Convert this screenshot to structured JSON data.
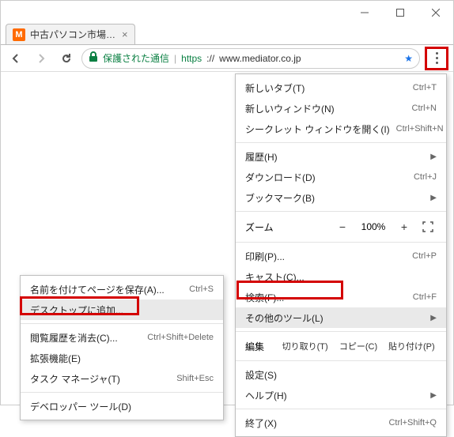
{
  "window": {
    "favicon_letter": "M",
    "tab_title": "中古パソコン市場 中古PCの"
  },
  "addr": {
    "secure_label": "保護された通信",
    "https": "https",
    "sep": "://",
    "rest": "www.mediator.co.jp"
  },
  "menu": {
    "new_tab": "新しいタブ(T)",
    "new_tab_sc": "Ctrl+T",
    "new_window": "新しいウィンドウ(N)",
    "new_window_sc": "Ctrl+N",
    "incognito": "シークレット ウィンドウを開く(I)",
    "incognito_sc": "Ctrl+Shift+N",
    "history": "履歴(H)",
    "downloads": "ダウンロード(D)",
    "downloads_sc": "Ctrl+J",
    "bookmarks": "ブックマーク(B)",
    "zoom_label": "ズーム",
    "zoom_value": "100%",
    "print": "印刷(P)...",
    "print_sc": "Ctrl+P",
    "cast": "キャスト(C)...",
    "find": "検索(F)...",
    "find_sc": "Ctrl+F",
    "more_tools": "その他のツール(L)",
    "edit_label": "編集",
    "cut": "切り取り(T)",
    "copy": "コピー(C)",
    "paste": "貼り付け(P)",
    "settings": "設定(S)",
    "help": "ヘルプ(H)",
    "exit": "終了(X)",
    "exit_sc": "Ctrl+Shift+Q"
  },
  "sub": {
    "save_as": "名前を付けてページを保存(A)...",
    "save_as_sc": "Ctrl+S",
    "add_desktop": "デスクトップに追加...",
    "clear_browsing": "閲覧履歴を消去(C)...",
    "clear_sc": "Ctrl+Shift+Delete",
    "extensions": "拡張機能(E)",
    "task_manager": "タスク マネージャ(T)",
    "task_sc": "Shift+Esc",
    "devtools": "デベロッパー ツール(D)"
  }
}
